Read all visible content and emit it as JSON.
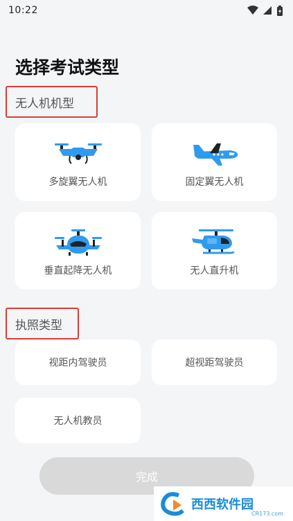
{
  "status_bar": {
    "time": "10:22"
  },
  "page": {
    "title": "选择考试类型"
  },
  "section_aircraft": {
    "label": "无人机机型",
    "items": [
      {
        "label": "多旋翼无人机",
        "icon": "multirotor-drone-icon"
      },
      {
        "label": "固定翼无人机",
        "icon": "fixed-wing-plane-icon"
      },
      {
        "label": "垂直起降无人机",
        "icon": "vtol-drone-icon"
      },
      {
        "label": "无人直升机",
        "icon": "helicopter-icon"
      }
    ]
  },
  "section_license": {
    "label": "执照类型",
    "items": [
      {
        "label": "视距内驾驶员"
      },
      {
        "label": "超视距驾驶员"
      },
      {
        "label": "无人机教员"
      }
    ]
  },
  "footer": {
    "finish_label": "完成"
  },
  "watermark": {
    "brand": "西西软件园",
    "url": "CR173.com"
  },
  "colors": {
    "icon_blue": "#2f9bf0",
    "icon_dark": "#222222",
    "highlight_red": "#d93b34",
    "button_disabled": "#d9d9d9"
  }
}
